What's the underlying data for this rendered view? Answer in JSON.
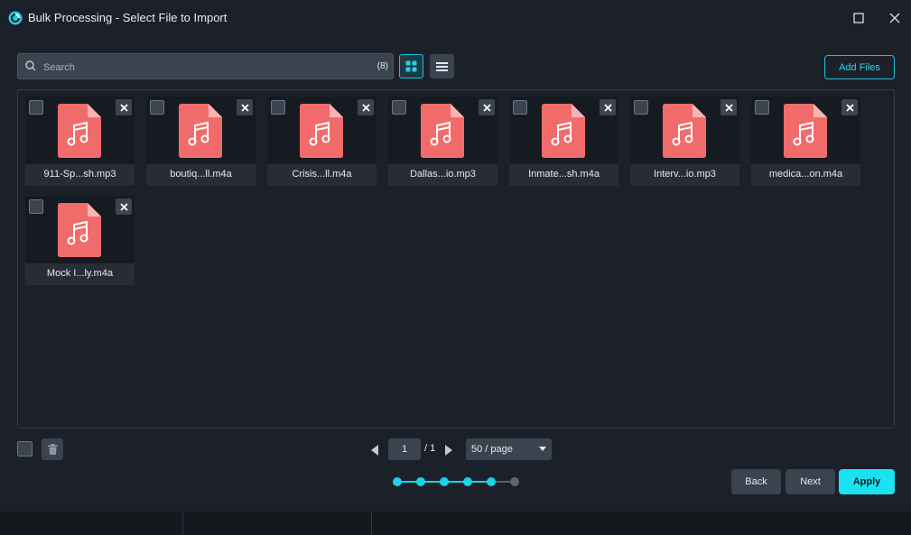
{
  "window": {
    "title": "Bulk Processing - Select File to Import"
  },
  "toolbar": {
    "search_placeholder": "Search",
    "search_count": "(8)",
    "add_files_label": "Add Files",
    "view_mode": "grid"
  },
  "files": [
    {
      "name": "911-Sp...sh.mp3"
    },
    {
      "name": "boutiq...ll.m4a"
    },
    {
      "name": "Crisis...ll.m4a"
    },
    {
      "name": "Dallas...io.mp3"
    },
    {
      "name": "Inmate...sh.m4a"
    },
    {
      "name": "Interv...io.mp3"
    },
    {
      "name": "medica...on.m4a"
    },
    {
      "name": "Mock I...ly.m4a"
    }
  ],
  "pagination": {
    "current_page": "1",
    "total_pages": "/ 1",
    "per_page": "50 / page"
  },
  "stepper": {
    "total_steps": 6,
    "active_step": 5
  },
  "footer": {
    "back_label": "Back",
    "next_label": "Next",
    "apply_label": "Apply"
  },
  "colors": {
    "accent": "#19c3d9",
    "file_icon": "#f26b6b",
    "background": "#1c2129"
  }
}
